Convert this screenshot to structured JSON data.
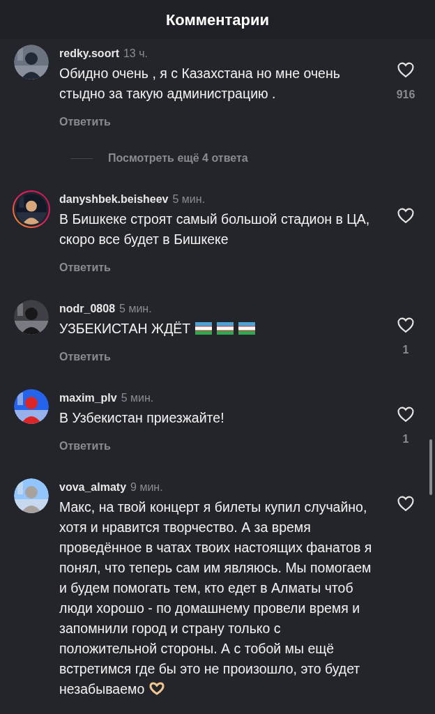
{
  "header": {
    "title": "Комментарии"
  },
  "comments": [
    {
      "username": "redky.soort",
      "time": "13 ч.",
      "text": "Обидно очень , я с Казахстана но мне очень стыдно за такую администрацию .",
      "reply": "Ответить",
      "likes": "916",
      "story_ring": false,
      "more_replies": "Посмотреть ещё 4 ответа"
    },
    {
      "username": "danyshbek.beisheev",
      "time": "5 мин.",
      "text": "В Бишкеке строят самый большой стадион в ЦА, скоро все будет в Бишкеке",
      "reply": "Ответить",
      "story_ring": true
    },
    {
      "username": "nodr_0808",
      "time": "5 мин.",
      "text": "УЗБЕКИСТАН ЖДЁТ",
      "trailing_icons": [
        {
          "kind": "flag"
        },
        {
          "kind": "flag"
        },
        {
          "kind": "flag"
        }
      ],
      "reply": "Ответить",
      "likes": "1",
      "story_ring": false
    },
    {
      "username": "maxim_plv",
      "time": "5 мин.",
      "text": "В Узбекистан приезжайте!",
      "reply": "Ответить",
      "likes": "1",
      "story_ring": false
    },
    {
      "username": "vova_almaty",
      "time": "9 мин.",
      "text": "Макс, на твой концерт я билеты купил случайно, хотя и нравится творчество. А за время проведённое в чатах твоих настоящих фанатов я понял, что теперь сам им являюсь. Мы помогаем и будем помогать тем, кто едет в Алматы чтоб люди хорошо - по домашнему провели время и запомнили город и страну только с положительной стороны. А с тобой мы ещё встретимся где бы это не произошло, это будет незабываемо",
      "trailing_icons": [
        {
          "kind": "heart-hands"
        }
      ],
      "story_ring": false
    }
  ]
}
